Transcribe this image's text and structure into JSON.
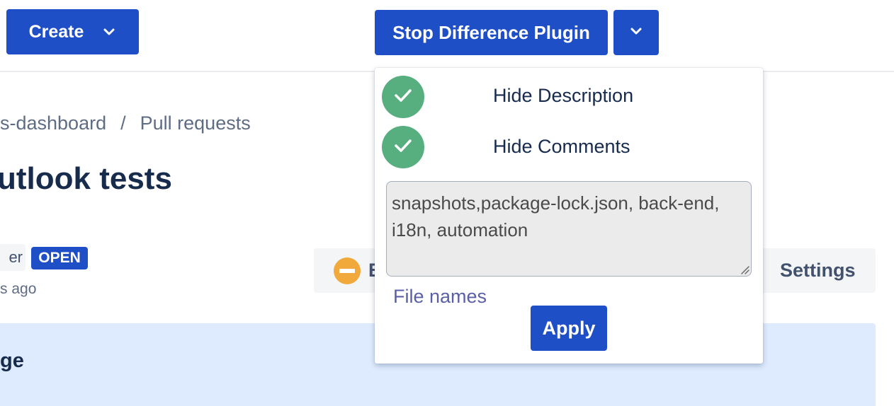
{
  "topbar": {
    "create_label": "Create",
    "plugin_button_label": "Stop Difference Plugin"
  },
  "breadcrumb": {
    "repo": "s-dashboard",
    "separator": "/",
    "section": "Pull requests"
  },
  "pull_request": {
    "title": "utlook tests",
    "author_fragment": "er",
    "status": "OPEN",
    "time_fragment": "s ago",
    "approve_fragment": "E",
    "settings_label": "Settings",
    "description_heading_fragment": "ge"
  },
  "plugin_dropdown": {
    "options": [
      {
        "label": "Hide Description",
        "checked": true
      },
      {
        "label": "Hide Comments",
        "checked": true
      }
    ],
    "file_names_value": "snapshots,package-lock.json, back-end, i18n, automation",
    "file_names_label": "File names",
    "apply_label": "Apply"
  },
  "colors": {
    "primary": "#1f4fc6",
    "check": "#57ae7f",
    "approve_icon": "#f0a93a",
    "description_bg": "#deebff",
    "link": "#5b5fa8"
  }
}
